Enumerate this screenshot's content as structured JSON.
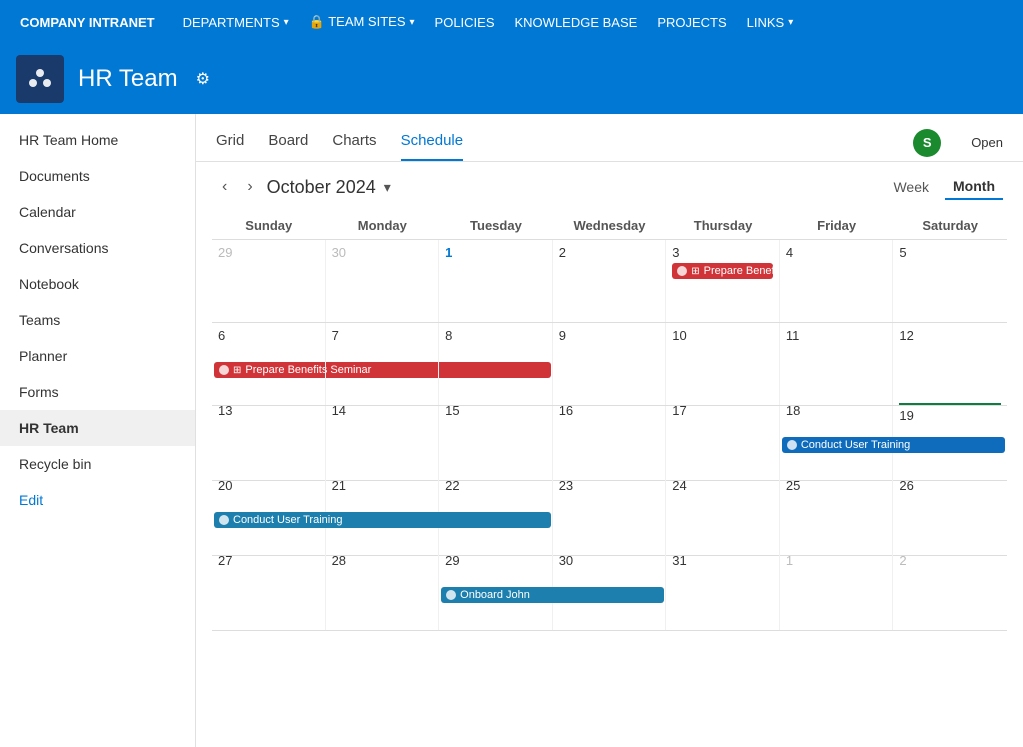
{
  "topnav": {
    "brand": "COMPANY INTRANET",
    "items": [
      {
        "label": "DEPARTMENTS",
        "hasChevron": true
      },
      {
        "label": "🔒 TEAM SITES",
        "hasChevron": true
      },
      {
        "label": "POLICIES",
        "hasChevron": false
      },
      {
        "label": "KNOWLEDGE BASE",
        "hasChevron": false
      },
      {
        "label": "PROJECTS",
        "hasChevron": false
      },
      {
        "label": "LINKS",
        "hasChevron": true
      }
    ]
  },
  "header": {
    "title": "HR Team",
    "settings_icon": "⚙"
  },
  "sidebar": {
    "items": [
      {
        "label": "HR Team Home",
        "active": false
      },
      {
        "label": "Documents",
        "active": false
      },
      {
        "label": "Calendar",
        "active": false
      },
      {
        "label": "Conversations",
        "active": false
      },
      {
        "label": "Notebook",
        "active": false
      },
      {
        "label": "Teams",
        "active": false
      },
      {
        "label": "Planner",
        "active": false
      },
      {
        "label": "Forms",
        "active": false
      },
      {
        "label": "HR Team",
        "active": true
      },
      {
        "label": "Recycle bin",
        "active": false
      },
      {
        "label": "Edit",
        "active": false,
        "isEdit": true
      }
    ]
  },
  "tabs": {
    "items": [
      {
        "label": "Grid",
        "active": false
      },
      {
        "label": "Board",
        "active": false
      },
      {
        "label": "Charts",
        "active": false
      },
      {
        "label": "Schedule",
        "active": true
      }
    ],
    "open_label": "Open"
  },
  "calendar": {
    "month": "October 2024",
    "view_week": "Week",
    "view_month": "Month",
    "headers": [
      "Sunday",
      "Monday",
      "Tuesday",
      "Wednesday",
      "Thursday",
      "Friday",
      "Saturday"
    ],
    "weeks": [
      {
        "days": [
          {
            "num": "29",
            "dim": true
          },
          {
            "num": "30",
            "dim": true
          },
          {
            "num": "1",
            "highlight": true
          },
          {
            "num": "2"
          },
          {
            "num": "3"
          },
          {
            "num": "4"
          },
          {
            "num": "5"
          }
        ],
        "events": [
          {
            "label": "Prepare Benefits Seminar",
            "type": "red",
            "col_start": 5,
            "col_end": 8,
            "icon": "🔴",
            "task_icon": "⊞"
          }
        ]
      },
      {
        "days": [
          {
            "num": "6"
          },
          {
            "num": "7"
          },
          {
            "num": "8"
          },
          {
            "num": "9"
          },
          {
            "num": "10"
          },
          {
            "num": "11"
          },
          {
            "num": "12"
          }
        ],
        "events": [
          {
            "label": "Prepare Benefits Seminar",
            "type": "red",
            "col_start": 1,
            "col_end": 4,
            "icon": "🔴",
            "task_icon": "⊞"
          }
        ]
      },
      {
        "days": [
          {
            "num": "13"
          },
          {
            "num": "14"
          },
          {
            "num": "15"
          },
          {
            "num": "16"
          },
          {
            "num": "17"
          },
          {
            "num": "18"
          },
          {
            "num": "19",
            "today": true
          }
        ],
        "events": [
          {
            "label": "Conduct User Training",
            "type": "blue",
            "col_start": 6,
            "col_end": 8,
            "icon": "🔵",
            "task_icon": ""
          }
        ]
      },
      {
        "days": [
          {
            "num": "20"
          },
          {
            "num": "21"
          },
          {
            "num": "22"
          },
          {
            "num": "23"
          },
          {
            "num": "24"
          },
          {
            "num": "25"
          },
          {
            "num": "26"
          }
        ],
        "events": [
          {
            "label": "Conduct User Training",
            "type": "teal",
            "col_start": 1,
            "col_end": 4,
            "icon": "🔵",
            "task_icon": ""
          }
        ]
      },
      {
        "days": [
          {
            "num": "27"
          },
          {
            "num": "28"
          },
          {
            "num": "29"
          },
          {
            "num": "30"
          },
          {
            "num": "31"
          },
          {
            "num": "1",
            "dim": true
          },
          {
            "num": "2",
            "dim": true
          }
        ],
        "events": [
          {
            "label": "Onboard John",
            "type": "teal",
            "col_start": 3,
            "col_end": 5,
            "icon": "🔵",
            "task_icon": ""
          }
        ]
      }
    ]
  }
}
